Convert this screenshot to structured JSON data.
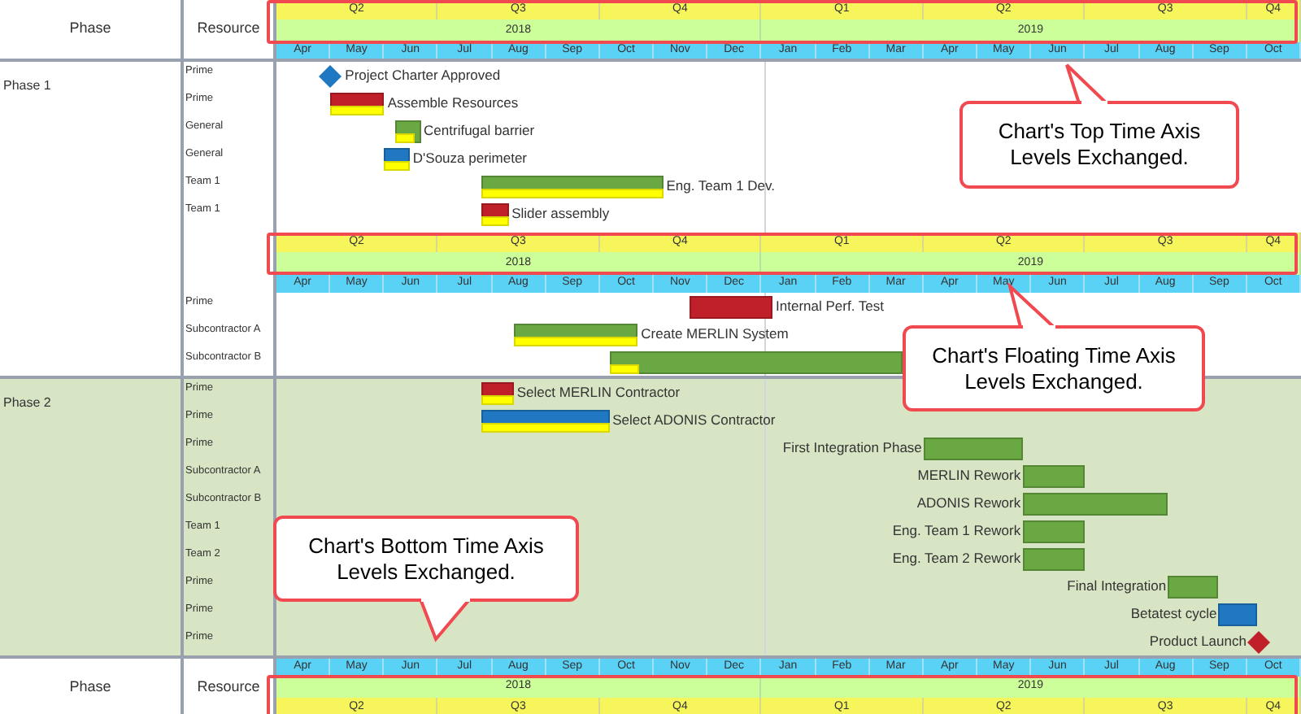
{
  "columns": {
    "phase": "Phase",
    "resource": "Resource"
  },
  "top_axis": {
    "highlight": true,
    "quarters": [
      "Q2",
      "Q3",
      "Q4",
      "Q1",
      "Q2",
      "Q3",
      "Q4"
    ],
    "years": [
      "2018",
      "2019"
    ],
    "months": [
      "Apr",
      "May",
      "Jun",
      "Jul",
      "Aug",
      "Sep",
      "Oct",
      "Nov",
      "Dec",
      "Jan",
      "Feb",
      "Mar",
      "Apr",
      "May",
      "Jun",
      "Jul",
      "Aug",
      "Sep",
      "Oct"
    ]
  },
  "phases": [
    {
      "name": "Phase 1",
      "shaded": false,
      "rows": [
        {
          "kind": "task",
          "resource": "Prime",
          "task": {
            "kind": "milestone",
            "label": "Project Charter Approved",
            "color": "#1f78c1"
          }
        },
        {
          "kind": "task",
          "resource": "Prime",
          "task": {
            "kind": "bar",
            "label": "Assemble Resources",
            "color": "#c0202a",
            "level": 1
          }
        },
        {
          "kind": "task",
          "resource": "General",
          "task": {
            "kind": "bar",
            "label": "Centrifugal barrier",
            "color": "#6aa843",
            "level": 0.8
          }
        },
        {
          "kind": "task",
          "resource": "General",
          "task": {
            "kind": "bar",
            "label": "D'Souza perimeter",
            "color": "#1f78c1",
            "level": 1
          }
        },
        {
          "kind": "task",
          "resource": "Team 1",
          "task": {
            "kind": "bar",
            "label": "Eng. Team 1 Dev.",
            "color": "#6aa843",
            "level": 1
          }
        },
        {
          "kind": "task",
          "resource": "Team 1",
          "task": {
            "kind": "bar",
            "label": "Slider assembly",
            "color": "#c0202a",
            "level": 1
          }
        },
        {
          "kind": "axis",
          "axis": {
            "highlight": true,
            "quarters": [
              "Q2",
              "Q3",
              "Q4",
              "Q1",
              "Q2",
              "Q3",
              "Q4"
            ],
            "years": [
              "2018",
              "2019"
            ],
            "months": [
              "Apr",
              "May",
              "Jun",
              "Jul",
              "Aug",
              "Sep",
              "Oct",
              "Nov",
              "Dec",
              "Jan",
              "Feb",
              "Mar",
              "Apr",
              "May",
              "Jun",
              "Jul",
              "Aug",
              "Sep",
              "Oct"
            ]
          }
        },
        {
          "kind": "task",
          "resource": "Prime",
          "task": {
            "kind": "bar",
            "label": "Internal Perf. Test",
            "color": "#c0202a"
          }
        },
        {
          "kind": "task",
          "resource": "Subcontractor A",
          "task": {
            "kind": "bar",
            "label": "Create MERLIN System",
            "color": "#6aa843",
            "level": 1
          }
        },
        {
          "kind": "task",
          "resource": "Subcontractor B",
          "task": {
            "kind": "bar",
            "color": "#6aa843",
            "level": 0.1
          }
        }
      ]
    },
    {
      "name": "Phase 2",
      "shaded": true,
      "rows": [
        {
          "kind": "task",
          "resource": "Prime",
          "task": {
            "kind": "bar",
            "label": "Select MERLIN Contractor",
            "color": "#c0202a",
            "level": 1
          }
        },
        {
          "kind": "task",
          "resource": "Prime",
          "task": {
            "kind": "bar",
            "label": "Select ADONIS Contractor",
            "color": "#1f78c1",
            "level": 1
          }
        },
        {
          "kind": "task",
          "resource": "Prime",
          "task": {
            "kind": "bar",
            "label": "First Integration Phase",
            "color": "#6aa843"
          }
        },
        {
          "kind": "task",
          "resource": "Subcontractor A",
          "task": {
            "kind": "bar",
            "label": "MERLIN Rework",
            "color": "#6aa843"
          }
        },
        {
          "kind": "task",
          "resource": "Subcontractor B",
          "task": {
            "kind": "bar",
            "label": "ADONIS Rework",
            "color": "#6aa843"
          }
        },
        {
          "kind": "task",
          "resource": "Team 1",
          "task": {
            "kind": "bar",
            "label": "Eng. Team 1 Rework",
            "color": "#6aa843"
          }
        },
        {
          "kind": "task",
          "resource": "Team 2",
          "task": {
            "kind": "bar",
            "label": "Eng. Team 2 Rework",
            "color": "#6aa843"
          }
        },
        {
          "kind": "task",
          "resource": "Prime",
          "task": {
            "kind": "bar",
            "label": "Final Integration",
            "color": "#6aa843"
          }
        },
        {
          "kind": "task",
          "resource": "Prime",
          "task": {
            "kind": "bar",
            "label": "Betatest cycle",
            "color": "#1f78c1"
          }
        },
        {
          "kind": "task",
          "resource": "Prime",
          "task": {
            "kind": "milestone",
            "label": "Product Launch",
            "color": "#c0202a"
          }
        }
      ]
    }
  ],
  "bottom_axis": {
    "highlight": true,
    "quarters": [
      "Q2",
      "Q3",
      "Q4",
      "Q1",
      "Q2",
      "Q3",
      "Q4"
    ],
    "years": [
      "2018",
      "2019"
    ],
    "months": [
      "Apr",
      "May",
      "Jun",
      "Jul",
      "Aug",
      "Sep",
      "Oct",
      "Nov",
      "Dec",
      "Jan",
      "Feb",
      "Mar",
      "Apr",
      "May",
      "Jun",
      "Jul",
      "Aug",
      "Sep",
      "Oct"
    ]
  },
  "footer_columns": {
    "phase": "Phase",
    "resource": "Resource"
  },
  "callouts": [
    {
      "text": "Chart's Top Time Axis Levels Exchanged."
    },
    {
      "text": "Chart's Floating Time Axis Levels Exchanged."
    },
    {
      "text": "Chart's Bottom Time Axis Levels Exchanged."
    }
  ]
}
